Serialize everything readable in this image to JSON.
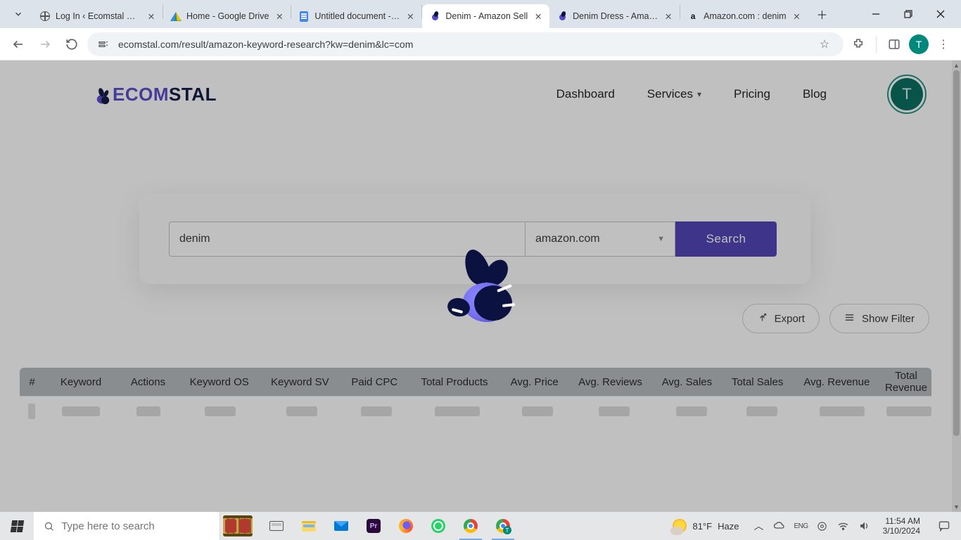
{
  "chrome": {
    "tabs": [
      {
        "title": "Log In ‹ Ecomstal — W",
        "fav": "globe",
        "active": false
      },
      {
        "title": "Home - Google Drive",
        "fav": "drive",
        "active": false
      },
      {
        "title": "Untitled document - G",
        "fav": "docs",
        "active": false
      },
      {
        "title": "Denim - Amazon Sell",
        "fav": "bee",
        "active": true
      },
      {
        "title": "Denim Dress - Amazo",
        "fav": "bee",
        "active": false
      },
      {
        "title": "Amazon.com : denim",
        "fav": "amzn",
        "active": false
      }
    ],
    "url": "ecomstal.com/result/amazon-keyword-research?kw=denim&lc=com",
    "profile_initial": "T"
  },
  "nav": {
    "items": [
      "Dashboard",
      "Services",
      "Pricing",
      "Blog"
    ],
    "avatar_initial": "T"
  },
  "search": {
    "keyword": "denim",
    "marketplace": "amazon.com",
    "button": "Search"
  },
  "actions": {
    "export": "Export",
    "show_filter": "Show Filter"
  },
  "table": {
    "headers": [
      "#",
      "Keyword",
      "Actions",
      "Keyword OS",
      "Keyword SV",
      "Paid CPC",
      "Total Products",
      "Avg. Price",
      "Avg. Reviews",
      "Avg. Sales",
      "Total Sales",
      "Avg. Revenue",
      "Total Revenue"
    ]
  },
  "taskbar": {
    "search_placeholder": "Type here to search",
    "weather_temp": "81°F",
    "weather_cond": "Haze",
    "time": "11:54 AM",
    "date": "3/10/2024"
  },
  "logo_text": {
    "a": "ECOM",
    "b": "STAL"
  }
}
